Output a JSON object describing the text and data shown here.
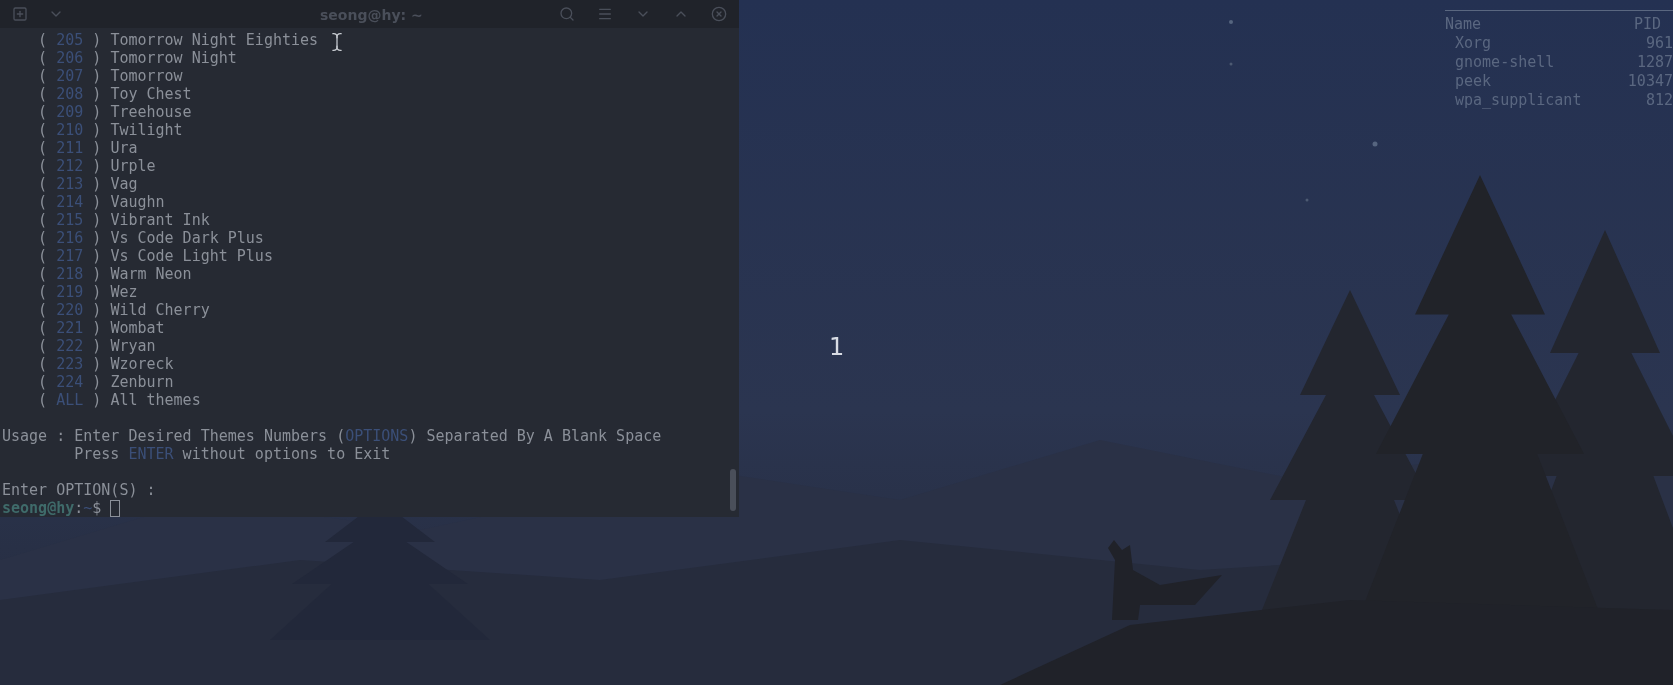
{
  "window": {
    "title": "seong@hy: ~"
  },
  "terminal": {
    "brackets": [
      "(",
      ")"
    ],
    "themes": [
      {
        "number": "205",
        "name": "Tomorrow Night Eighties"
      },
      {
        "number": "206",
        "name": "Tomorrow Night"
      },
      {
        "number": "207",
        "name": "Tomorrow"
      },
      {
        "number": "208",
        "name": "Toy Chest"
      },
      {
        "number": "209",
        "name": "Treehouse"
      },
      {
        "number": "210",
        "name": "Twilight"
      },
      {
        "number": "211",
        "name": "Ura"
      },
      {
        "number": "212",
        "name": "Urple"
      },
      {
        "number": "213",
        "name": "Vag"
      },
      {
        "number": "214",
        "name": "Vaughn"
      },
      {
        "number": "215",
        "name": "Vibrant Ink"
      },
      {
        "number": "216",
        "name": "Vs Code Dark Plus"
      },
      {
        "number": "217",
        "name": "Vs Code Light Plus"
      },
      {
        "number": "218",
        "name": "Warm Neon"
      },
      {
        "number": "219",
        "name": "Wez"
      },
      {
        "number": "220",
        "name": "Wild Cherry"
      },
      {
        "number": "221",
        "name": "Wombat"
      },
      {
        "number": "222",
        "name": "Wryan"
      },
      {
        "number": "223",
        "name": "Wzoreck"
      },
      {
        "number": "224",
        "name": "Zenburn"
      },
      {
        "number": "ALL",
        "name": "All themes"
      }
    ],
    "usage_lines": [
      [
        {
          "kind": "plain",
          "text": "Usage : Enter Desired Themes Numbers ("
        },
        {
          "kind": "keyword",
          "text": "OPTIONS"
        },
        {
          "kind": "plain",
          "text": ") Separated By A Blank Space"
        }
      ],
      [
        {
          "kind": "indent"
        },
        {
          "kind": "plain",
          "text": "Press "
        },
        {
          "kind": "keyword",
          "text": "ENTER"
        },
        {
          "kind": "plain",
          "text": " without options to Exit"
        }
      ]
    ],
    "input_prompt": "Enter OPTION(S) :",
    "shell_prompt": {
      "user_host": "seong@hy",
      "separator": ":",
      "path": "~",
      "symbol": "$"
    }
  },
  "process_list": {
    "columns": [
      "Name",
      "PID"
    ],
    "rows": [
      {
        "name": "Xorg",
        "pid": "961"
      },
      {
        "name": "gnome-shell",
        "pid": "1287"
      },
      {
        "name": "peek",
        "pid": "10347"
      },
      {
        "name": "wpa_supplicant",
        "pid": "812"
      }
    ]
  },
  "workspace_indicator": "1"
}
